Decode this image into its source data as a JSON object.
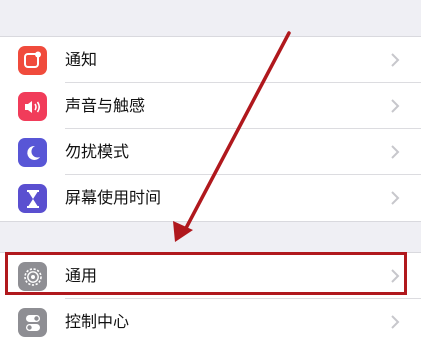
{
  "settings": {
    "items": [
      {
        "label": "通知",
        "icon": "notifications-icon",
        "color": "#f04b3c"
      },
      {
        "label": "声音与触感",
        "icon": "speaker-icon",
        "color": "#f13c5a"
      },
      {
        "label": "勿扰模式",
        "icon": "moon-icon",
        "color": "#5856d6"
      },
      {
        "label": "屏幕使用时间",
        "icon": "hourglass-icon",
        "color": "#5a4fd0"
      },
      {
        "label": "通用",
        "icon": "gear-icon",
        "color": "#8e8e93"
      },
      {
        "label": "控制中心",
        "icon": "control-center-icon",
        "color": "#8e8e93"
      }
    ]
  },
  "annotation": {
    "highlighted_item": "通用",
    "color": "#b0181d"
  }
}
